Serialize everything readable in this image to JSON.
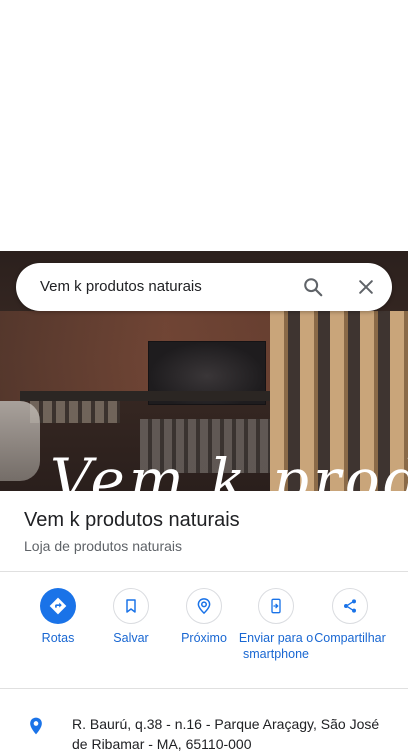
{
  "search": {
    "query": "Vem k produtos naturais"
  },
  "icons": {
    "search": "search-icon",
    "close": "close-icon",
    "location": "location-pin-icon"
  },
  "photo": {
    "overlay_script": "Vem k produtos"
  },
  "place": {
    "name": "Vem k produtos naturais",
    "category": "Loja de produtos naturais",
    "address": "R. Baurú, q.38 - n.16 - Parque Araçagy, São José de Ribamar - MA, 65110-000"
  },
  "actions": [
    {
      "label": "Rotas",
      "icon": "directions-icon",
      "primary": true
    },
    {
      "label": "Salvar",
      "icon": "bookmark-icon",
      "primary": false
    },
    {
      "label": "Próximo",
      "icon": "nearby-icon",
      "primary": false
    },
    {
      "label": "Enviar para o smartphone",
      "icon": "send-to-phone-icon",
      "primary": false
    },
    {
      "label": "Compartilhar",
      "icon": "share-icon",
      "primary": false
    }
  ],
  "colors": {
    "accent": "#1a73e8",
    "link": "#1967d2",
    "text": "#202124",
    "secondary": "#5f6368"
  }
}
